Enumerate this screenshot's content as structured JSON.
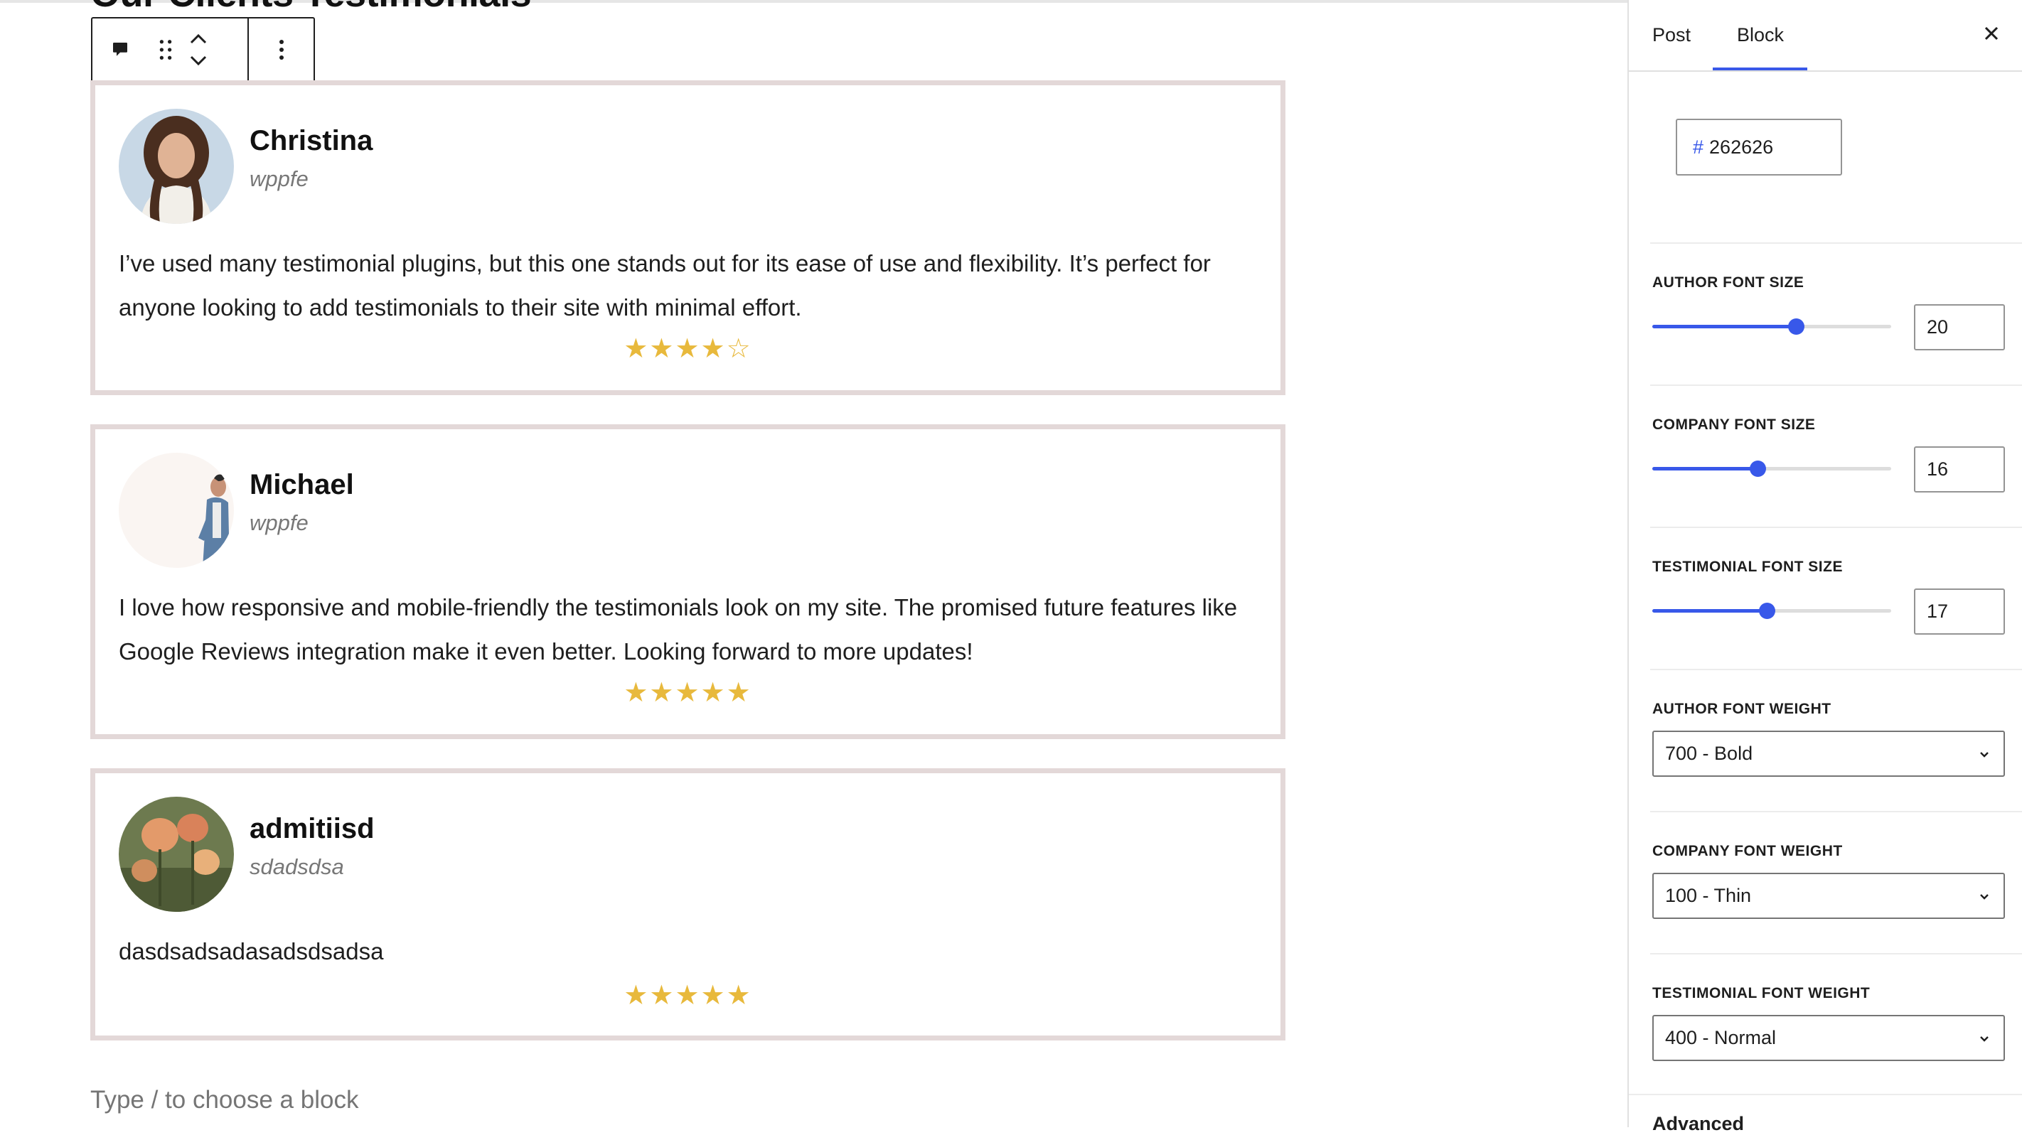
{
  "canvas": {
    "heading": "Our Clients Testimonials",
    "placeholder": "Type / to choose a block",
    "testimonials": [
      {
        "author": "Christina",
        "company": "wppfe",
        "text": "I’ve used many testimonial plugins, but this one stands out for its ease of use and flexibility. It’s perfect for anyone looking to add testimonials to their site with minimal effort.",
        "rating": 4,
        "stars": "★★★★☆"
      },
      {
        "author": "Michael",
        "company": "wppfe",
        "text": "I love how responsive and mobile-friendly the testimonials look on my site. The promised future features like Google Reviews integration make it even better. Looking forward to more updates!",
        "rating": 5,
        "stars": "★★★★★"
      },
      {
        "author": "admitiisd",
        "company": "sdadsdsa",
        "text": "dasdsadsadasadsdsadsa",
        "rating": 5,
        "stars": "★★★★★"
      }
    ]
  },
  "toolbar": {
    "icons": [
      "comment-icon",
      "drag-handle-icon",
      "chevron-up-icon",
      "chevron-down-icon",
      "more-options-icon"
    ]
  },
  "sidebar": {
    "tabs": [
      "Post",
      "Block"
    ],
    "active_tab": "Block",
    "hash": "#",
    "color_hex": "262626",
    "controls": [
      {
        "label": "AUTHOR FONT SIZE",
        "value": "20",
        "fraction": 0.6
      },
      {
        "label": "COMPANY FONT SIZE",
        "value": "16",
        "fraction": 0.44
      },
      {
        "label": "TESTIMONIAL FONT SIZE",
        "value": "17",
        "fraction": 0.48
      }
    ],
    "selects": [
      {
        "label": "AUTHOR FONT WEIGHT",
        "value": "700 - Bold"
      },
      {
        "label": "COMPANY FONT WEIGHT",
        "value": "100 - Thin"
      },
      {
        "label": "TESTIMONIAL FONT WEIGHT",
        "value": "400 - Normal"
      }
    ],
    "advanced_label": "Advanced"
  },
  "colors": {
    "accent": "#3858e9",
    "star": "#e8b93c",
    "card_border": "#e3d8d8"
  }
}
